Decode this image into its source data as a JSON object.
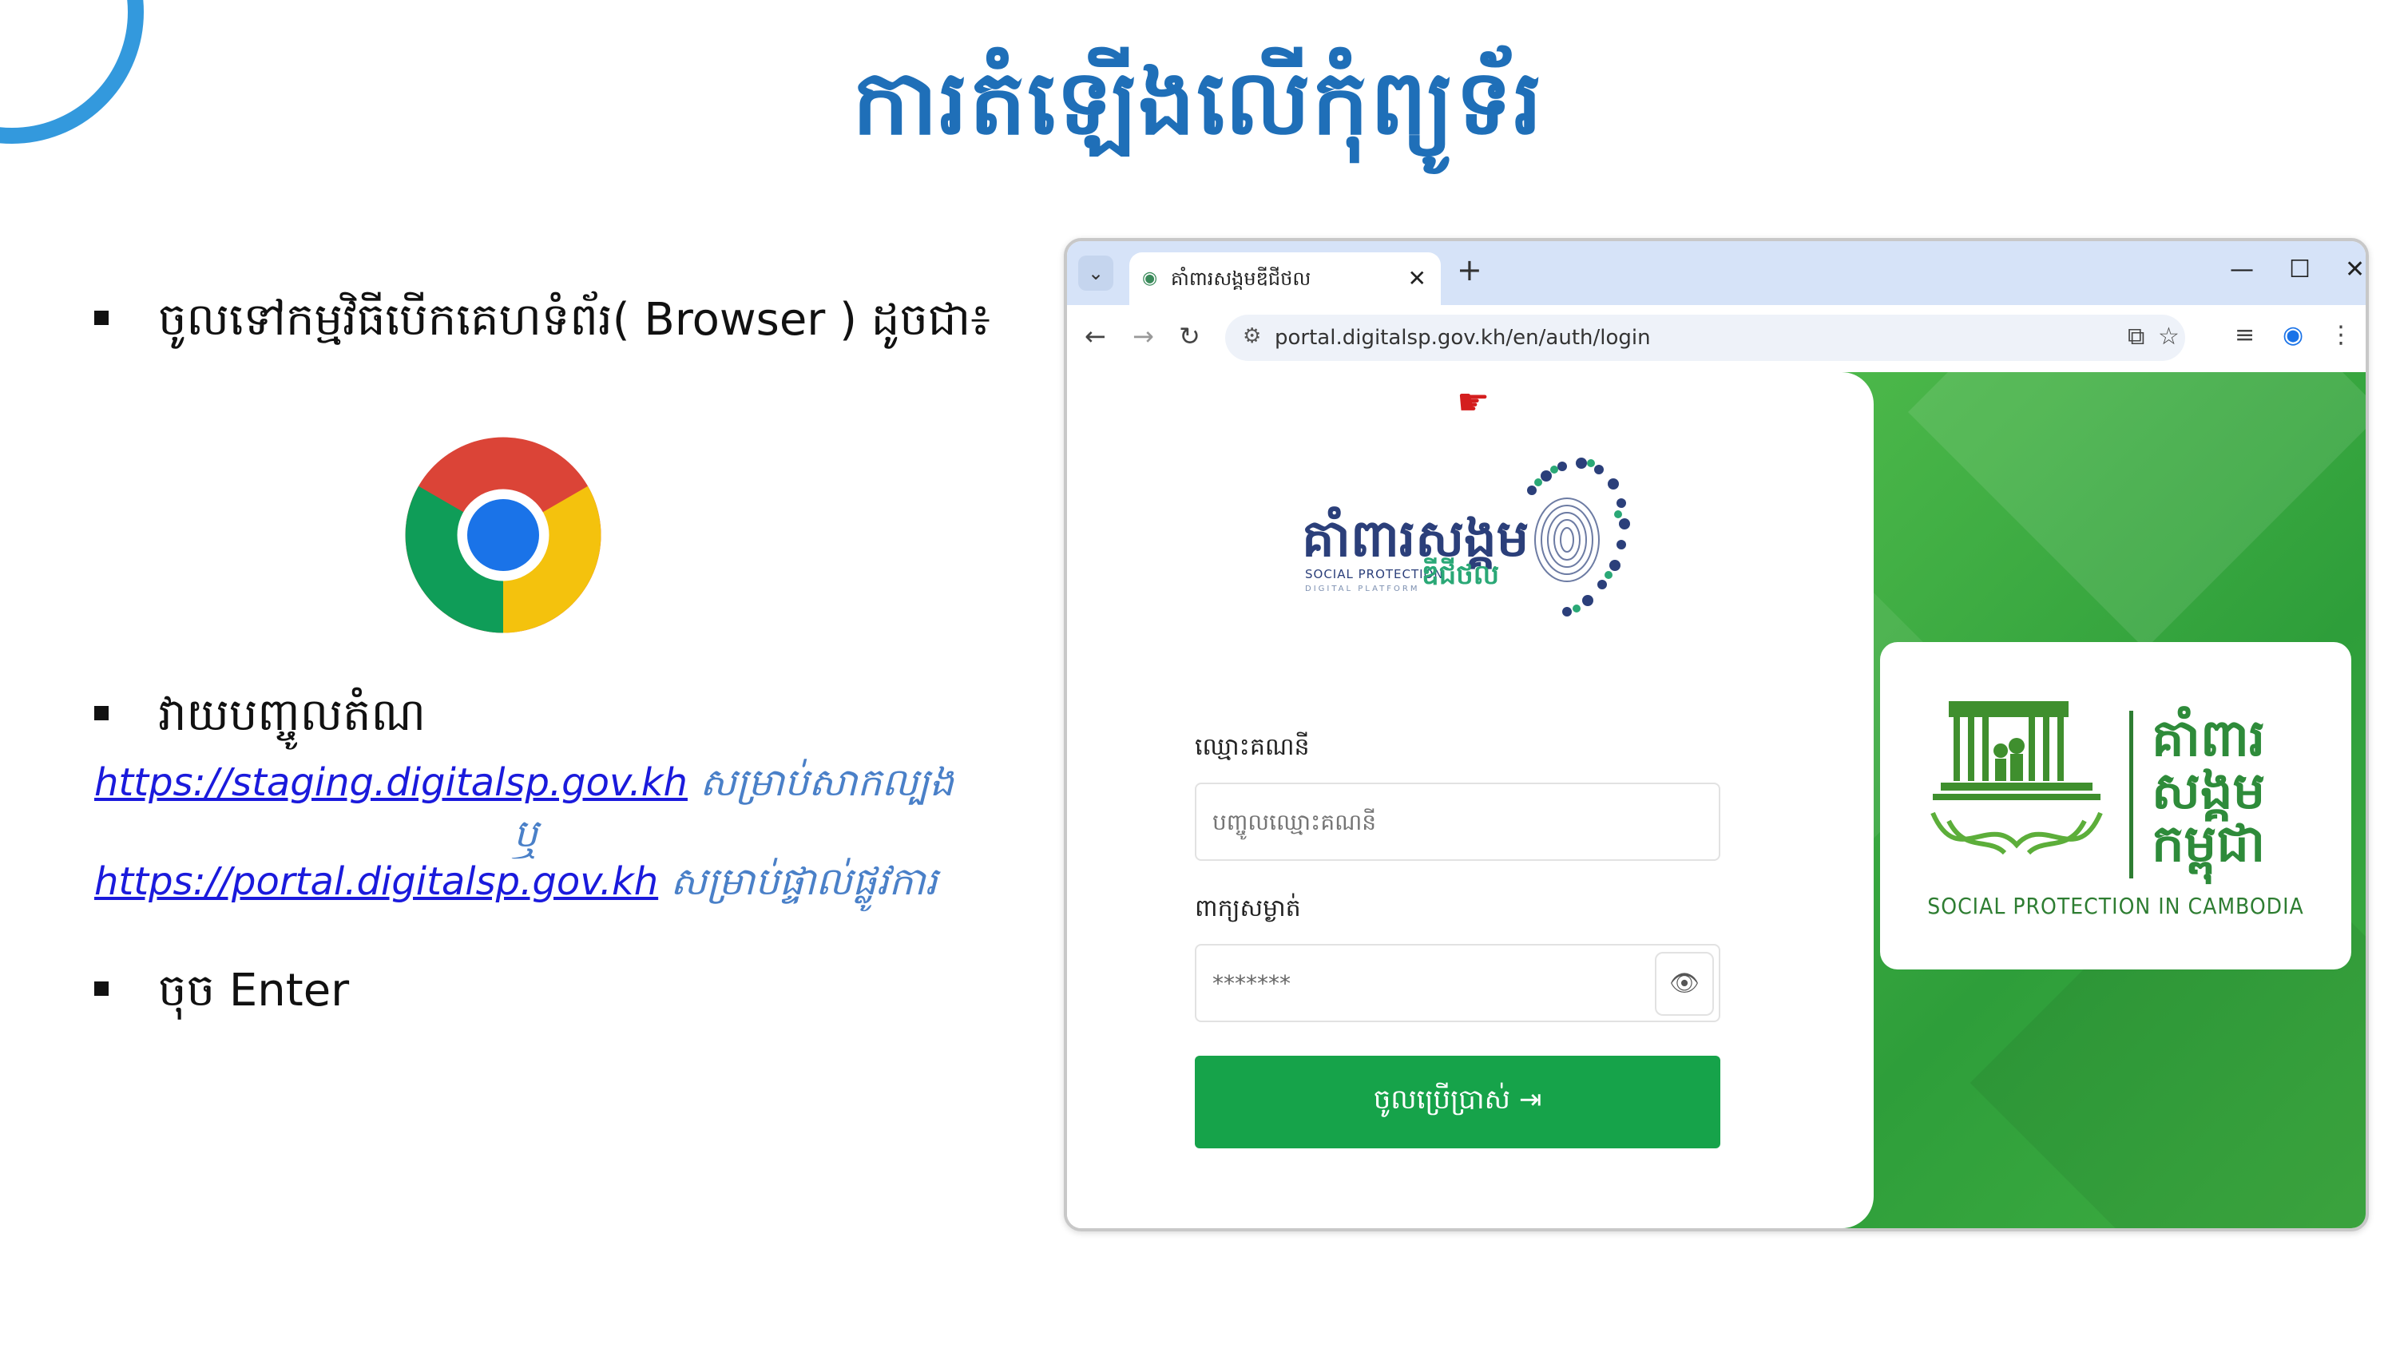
{
  "slide": {
    "title": "ការតំឡើងលើកុំព្យូទ័រ",
    "bullet1": "ចូលទៅកម្មវិធីបើកគេហទំព័រ( Browser ) ដូចជា៖",
    "bullet2": "វាយបញ្ចូលតំណ",
    "bullet3": "ចុច Enter",
    "link1": "https://staging.digitalsp.gov.kh",
    "link1_note": " សម្រាប់សាកល្បង",
    "or_text": "ឬ",
    "link2": "https://portal.digitalsp.gov.kh",
    "link2_note": " សម្រាប់ផ្ទាល់ផ្លូវការ",
    "chrome_icon": "chrome-logo-icon"
  },
  "browser": {
    "tab_title": "គាំពារសង្គមឌីជីថល",
    "url": "portal.digitalsp.gov.kh/en/auth/login",
    "new_tab": "+",
    "icons": [
      "chevron-down-icon",
      "close-icon",
      "minimize-icon",
      "maximize-icon",
      "back-icon",
      "forward-icon",
      "reload-icon",
      "tune-icon",
      "install-icon",
      "star-icon",
      "media-icon",
      "profile-icon",
      "menu-icon"
    ]
  },
  "login": {
    "logo_kh": "គាំពារសង្គម",
    "logo_en": "SOCIAL PROTECTION",
    "logo_en_sub": "DIGITAL PLATFORM",
    "logo_kh2": "ឌីជីថល",
    "username_label": "ឈ្មោះគណនី",
    "username_placeholder": "បញ្ចូលឈ្មោះគណនី",
    "password_label": "ពាក្យសម្ងាត់",
    "password_value": "*******",
    "submit_label": "ចូលប្រើប្រាស់ ⇥"
  },
  "brand": {
    "kh_line1": "គាំពារ",
    "kh_line2": "សង្គម",
    "kh_line3": "កម្ពុជា",
    "en": "SOCIAL PROTECTION IN CAMBODIA"
  },
  "colors": {
    "title_blue": "#1f6fb8",
    "link_blue": "#1a1adc",
    "note_blue": "#4a80c8",
    "green": "#16a34a"
  }
}
